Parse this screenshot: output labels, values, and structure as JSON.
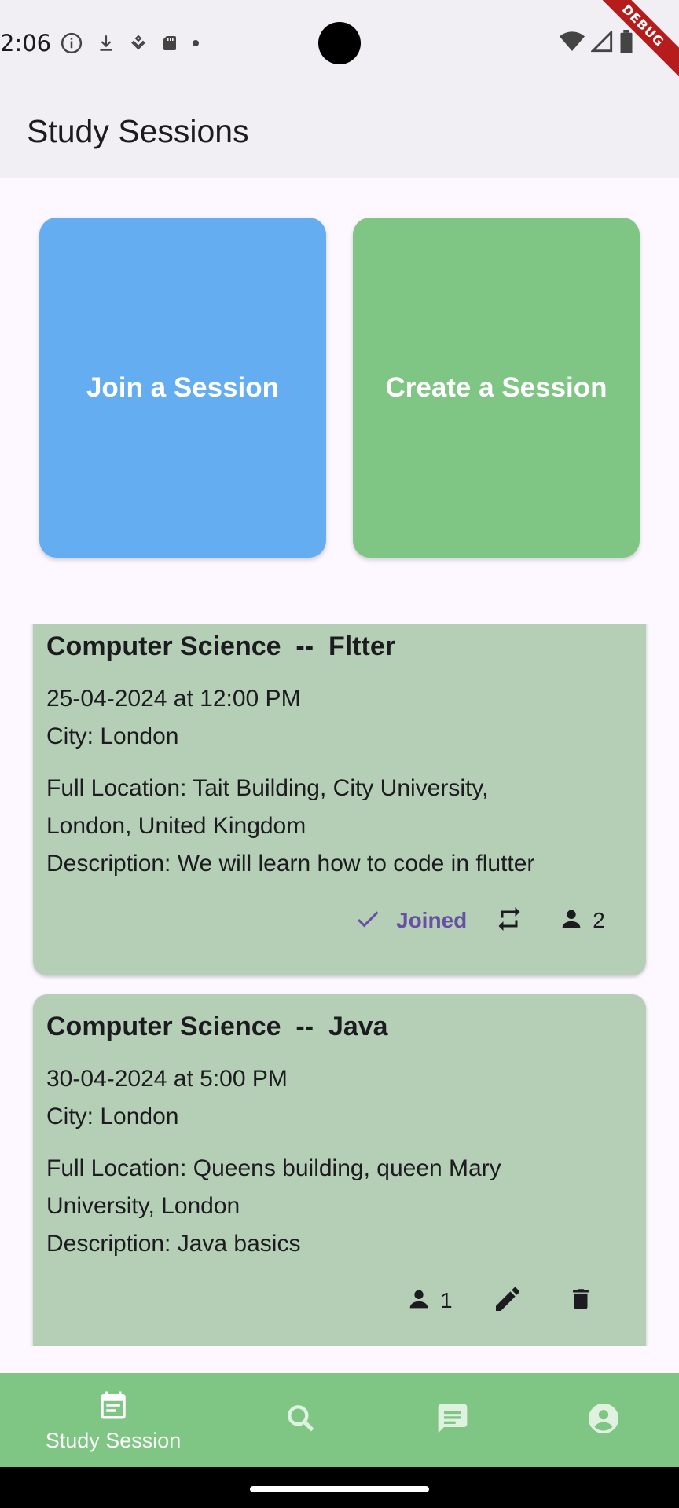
{
  "status_bar": {
    "time": "2:06",
    "debug_banner": "DEBUG"
  },
  "app_bar": {
    "title": "Study Sessions"
  },
  "actions": {
    "join_label": "Join a Session",
    "create_label": "Create a Session",
    "join_color": "#64adf0",
    "create_color": "#7fc583"
  },
  "sessions": [
    {
      "title": "Computer Science  --  Fltter",
      "datetime": "25-04-2024 at 12:00 PM",
      "city": "City: London",
      "location_line1": "Full Location: Tait Building, City University,",
      "location_line2": "London, United Kingdom",
      "description": "Description: We will learn how to code in flutter",
      "status": "Joined",
      "attendees": "2"
    },
    {
      "title": "Computer Science  --  Java",
      "datetime": "30-04-2024 at 5:00 PM",
      "city": "City: London",
      "location_line1": "Full Location: Queens building, queen Mary",
      "location_line2": "University, London",
      "description": "Description: Java basics",
      "attendees": "1"
    }
  ],
  "bottom_nav": {
    "items": [
      {
        "label": "Study Session",
        "icon": "calendar-icon"
      },
      {
        "label": "",
        "icon": "search-icon"
      },
      {
        "label": "",
        "icon": "chat-icon"
      },
      {
        "label": "",
        "icon": "account-icon"
      }
    ],
    "background": "#7fc583"
  }
}
